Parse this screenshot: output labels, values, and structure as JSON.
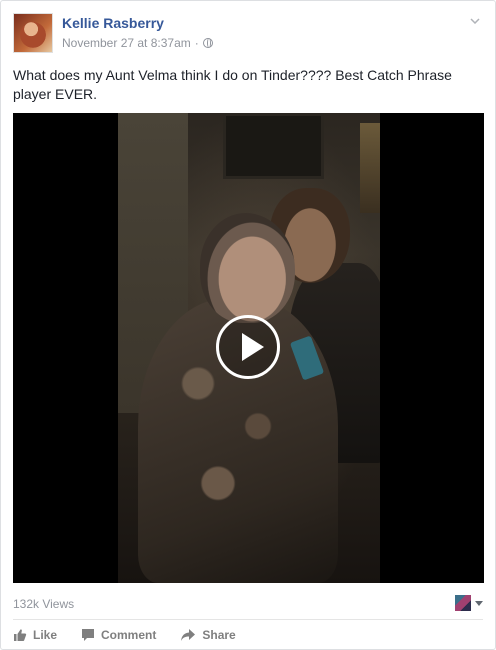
{
  "post": {
    "author": "Kellie Rasberry",
    "timestamp": "November 27 at 8:37am",
    "separator": "·",
    "privacy_icon": "globe-icon",
    "text": "What does my Aunt Velma think I do on Tinder???? Best Catch Phrase player EVER."
  },
  "video": {
    "play_icon": "play-icon",
    "views": "132k Views"
  },
  "actions": {
    "like_label": "Like",
    "comment_label": "Comment",
    "share_label": "Share"
  },
  "colors": {
    "author": "#365899",
    "meta": "#90949c",
    "action": "#7f7f7f"
  }
}
